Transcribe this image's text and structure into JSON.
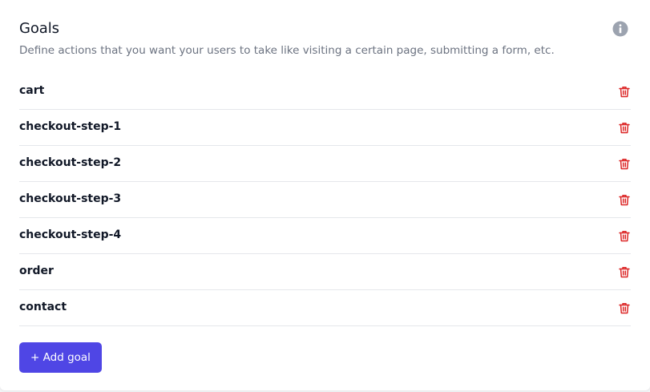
{
  "goals_panel": {
    "title": "Goals",
    "description": "Define actions that you want your users to take like visiting a certain page, submitting a form, etc.",
    "info_icon": "info-circle-icon",
    "delete_icon": "trash-icon",
    "items": [
      {
        "name": "cart"
      },
      {
        "name": "checkout-step-1"
      },
      {
        "name": "checkout-step-2"
      },
      {
        "name": "checkout-step-3"
      },
      {
        "name": "checkout-step-4"
      },
      {
        "name": "order"
      },
      {
        "name": "contact"
      }
    ],
    "add_button_label": "+ Add goal"
  },
  "colors": {
    "accent": "#4f46e5",
    "delete": "#dc2626",
    "info_icon": "#9ca3af",
    "divider": "#e5e7eb"
  }
}
